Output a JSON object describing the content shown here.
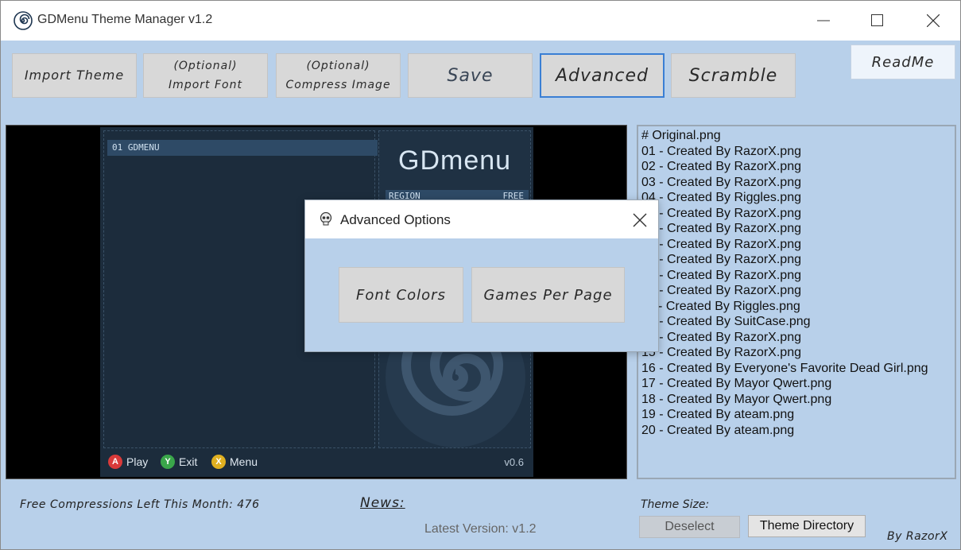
{
  "window": {
    "title": "GDMenu Theme Manager v1.2"
  },
  "toolbar": {
    "import_theme": "Import Theme",
    "import_font_line1": "(Optional)",
    "import_font_line2": "Import Font",
    "compress_line1": "(Optional)",
    "compress_line2": "Compress Image",
    "save": "Save",
    "advanced": "Advanced",
    "scramble": "Scramble",
    "readme": "ReadMe"
  },
  "preview": {
    "selected_game": "01 GDMENU",
    "logo": "GDmenu",
    "region_label": "REGION",
    "region_value": "FREE",
    "hints": [
      {
        "button": "A",
        "label": "Play",
        "color": "#d93a3a"
      },
      {
        "button": "Y",
        "label": "Exit",
        "color": "#3aa64a"
      },
      {
        "button": "X",
        "label": "Menu",
        "color": "#e0b020"
      }
    ],
    "version": "v0.6"
  },
  "themes": [
    "# Original.png",
    "01 - Created By RazorX.png",
    "02 - Created By RazorX.png",
    "03 - Created By RazorX.png",
    "04 - Created By Riggles.png",
    "05 - Created By RazorX.png",
    "06 - Created By RazorX.png",
    "07 - Created By RazorX.png",
    "08 - Created By RazorX.png",
    "09 - Created By RazorX.png",
    "10 - Created By RazorX.png",
    "11 - Created By Riggles.png",
    "12 - Created By SuitCase.png",
    "13 - Created By RazorX.png",
    "15 - Created By RazorX.png",
    "16 - Created By Everyone's Favorite Dead Girl.png",
    "17 - Created By Mayor Qwert.png",
    "18 - Created By Mayor Qwert.png",
    "19 - Created By ateam.png",
    "20 - Created By ateam.png"
  ],
  "dialog": {
    "title": "Advanced Options",
    "font_colors": "Font Colors",
    "games_per_page": "Games Per Page"
  },
  "footer": {
    "free_compressions": "Free Compressions Left This Month: 476",
    "news": "News:",
    "latest_version": "Latest Version:  v1.2",
    "theme_size": "Theme Size:",
    "deselect": "Deselect",
    "theme_directory": "Theme Directory",
    "author": "By RazorX"
  }
}
